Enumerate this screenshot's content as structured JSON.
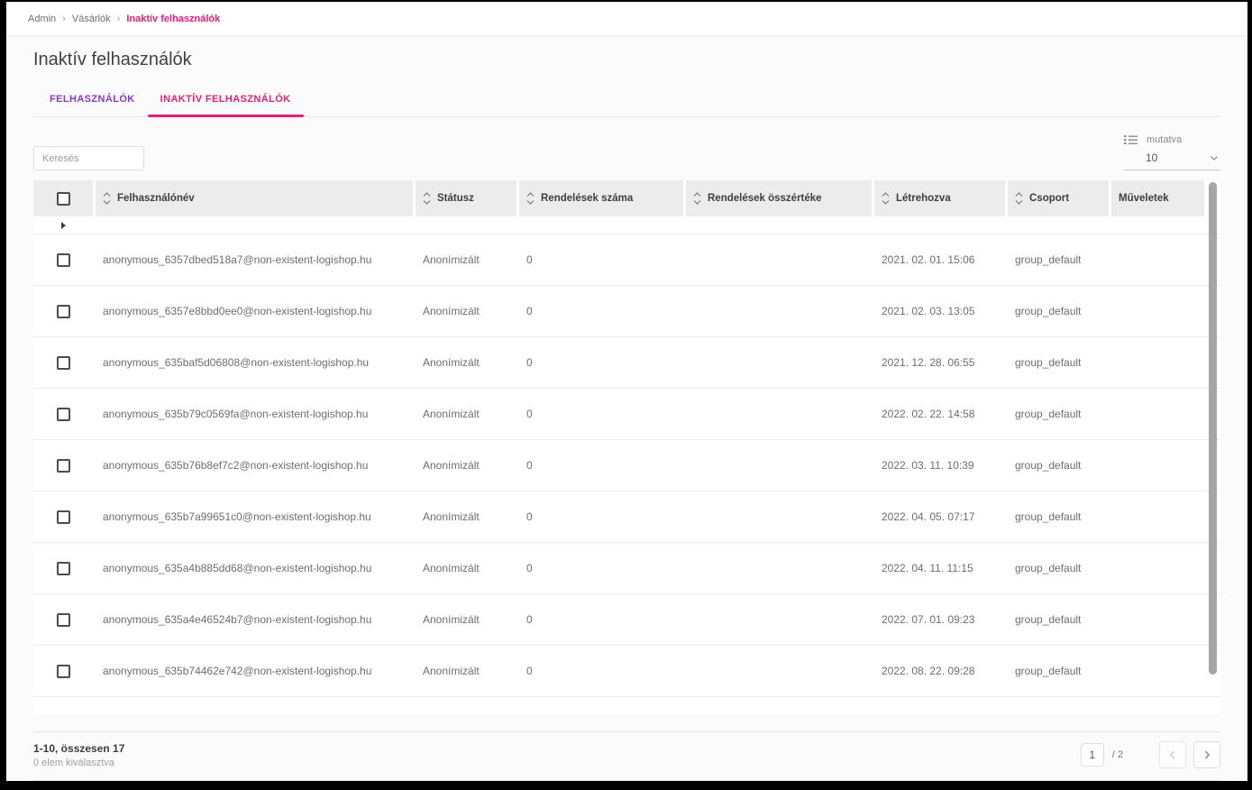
{
  "breadcrumb": {
    "separator": "›",
    "items": [
      {
        "label": "Admin"
      },
      {
        "label": "Vásárlók"
      },
      {
        "label": "Inaktív felhasználók"
      }
    ]
  },
  "page": {
    "title": "Inaktív felhasználók"
  },
  "tabs": [
    {
      "label": "FELHASZNÁLÓK",
      "active": false
    },
    {
      "label": "INAKTÍV FELHASZNÁLÓK",
      "active": true
    }
  ],
  "toolbar": {
    "search_placeholder": "Keresés",
    "per_page_label": "mutatva",
    "per_page_value": "10"
  },
  "table": {
    "columns": [
      {
        "key": "select",
        "label": "",
        "type": "checkbox",
        "sortable": false
      },
      {
        "key": "username",
        "label": "Felhasználónév",
        "sortable": true
      },
      {
        "key": "status",
        "label": "Státusz",
        "sortable": true
      },
      {
        "key": "orders_count",
        "label": "Rendelések száma",
        "sortable": true
      },
      {
        "key": "orders_value",
        "label": "Rendelések összértéke",
        "sortable": true
      },
      {
        "key": "created",
        "label": "Létrehozva",
        "sortable": true
      },
      {
        "key": "group",
        "label": "Csoport",
        "sortable": true
      },
      {
        "key": "actions",
        "label": "Műveletek",
        "sortable": false
      }
    ],
    "rows": [
      {
        "username": "anonymous_6357dbed518a7@non-existent-logishop.hu",
        "status": "Anonímizált",
        "orders_count": "0",
        "orders_value": "",
        "created": "2021. 02. 01. 15:06",
        "group": "group_default",
        "actions": ""
      },
      {
        "username": "anonymous_6357e8bbd0ee0@non-existent-logishop.hu",
        "status": "Anonímizált",
        "orders_count": "0",
        "orders_value": "",
        "created": "2021. 02. 03. 13:05",
        "group": "group_default",
        "actions": ""
      },
      {
        "username": "anonymous_635baf5d06808@non-existent-logishop.hu",
        "status": "Anonímizált",
        "orders_count": "0",
        "orders_value": "",
        "created": "2021. 12. 28. 06:55",
        "group": "group_default",
        "actions": ""
      },
      {
        "username": "anonymous_635b79c0569fa@non-existent-logishop.hu",
        "status": "Anonímizált",
        "orders_count": "0",
        "orders_value": "",
        "created": "2022. 02. 22. 14:58",
        "group": "group_default",
        "actions": ""
      },
      {
        "username": "anonymous_635b76b8ef7c2@non-existent-logishop.hu",
        "status": "Anonímizált",
        "orders_count": "0",
        "orders_value": "",
        "created": "2022. 03. 11. 10:39",
        "group": "group_default",
        "actions": ""
      },
      {
        "username": "anonymous_635b7a99651c0@non-existent-logishop.hu",
        "status": "Anonímizált",
        "orders_count": "0",
        "orders_value": "",
        "created": "2022. 04. 05. 07:17",
        "group": "group_default",
        "actions": ""
      },
      {
        "username": "anonymous_635a4b885dd68@non-existent-logishop.hu",
        "status": "Anonímizált",
        "orders_count": "0",
        "orders_value": "",
        "created": "2022. 04. 11. 11:15",
        "group": "group_default",
        "actions": ""
      },
      {
        "username": "anonymous_635a4e46524b7@non-existent-logishop.hu",
        "status": "Anonímizált",
        "orders_count": "0",
        "orders_value": "",
        "created": "2022. 07. 01. 09:23",
        "group": "group_default",
        "actions": ""
      },
      {
        "username": "anonymous_635b74462e742@non-existent-logishop.hu",
        "status": "Anonímizált",
        "orders_count": "0",
        "orders_value": "",
        "created": "2022. 08. 22. 09:28",
        "group": "group_default",
        "actions": ""
      }
    ]
  },
  "footer": {
    "range_summary": "1-10, összesen 17",
    "selection_summary": "0 elem kiválasztva",
    "pagination": {
      "current_page": "1",
      "total_pages": "/ 2"
    }
  },
  "icons": {
    "per_page": "list-icon",
    "per_page_chevron": "chevron-down-icon",
    "sort": "sort-arrows-icon",
    "filter_expand": "expand-triangle-icon",
    "prev": "chevron-left-icon",
    "next": "chevron-right-icon"
  },
  "colors": {
    "accent_pink": "#e61e78",
    "tab_purple": "#8d36c9",
    "header_bg": "#ececec"
  }
}
